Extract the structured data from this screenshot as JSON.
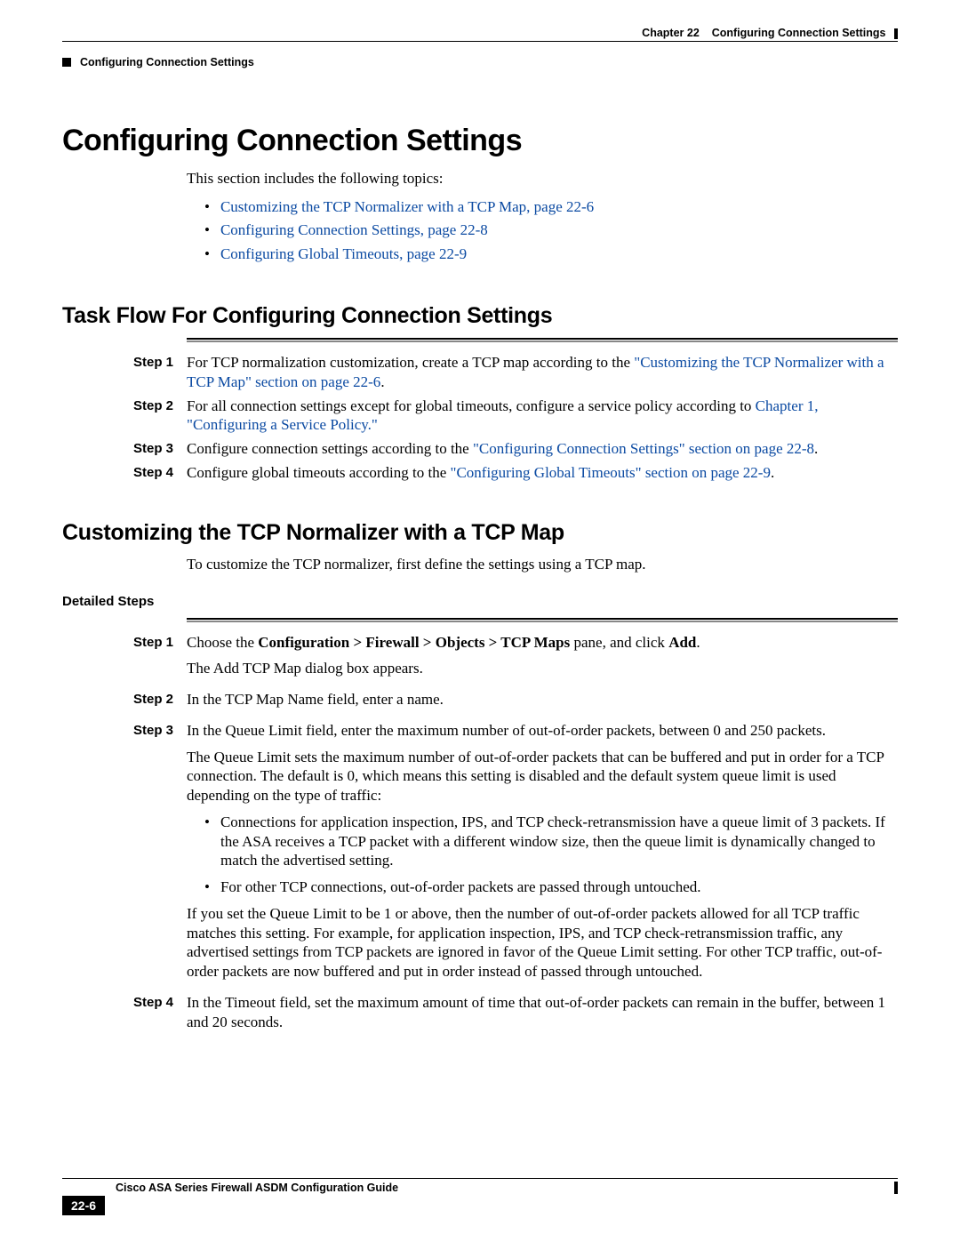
{
  "header": {
    "chapter_label": "Chapter 22",
    "chapter_title": "Configuring Connection Settings",
    "section_title": "Configuring Connection Settings"
  },
  "h1": "Configuring Connection Settings",
  "intro": "This section includes the following topics:",
  "intro_links": [
    "Customizing the TCP Normalizer with a TCP Map, page 22-6",
    "Configuring Connection Settings, page 22-8",
    "Configuring Global Timeouts, page 22-9"
  ],
  "task_flow": {
    "heading": "Task Flow For Configuring Connection Settings",
    "steps": [
      {
        "label": "Step 1",
        "pre": "For TCP normalization customization, create a TCP map according to the ",
        "link": "\"Customizing the TCP Normalizer with a TCP Map\" section on page 22-6",
        "post": "."
      },
      {
        "label": "Step 2",
        "pre": "For all connection settings except for global timeouts, configure a service policy according to ",
        "link": "Chapter 1, \"Configuring a Service Policy.\"",
        "post": ""
      },
      {
        "label": "Step 3",
        "pre": "Configure connection settings according to the ",
        "link": "\"Configuring Connection Settings\" section on page 22-8",
        "post": "."
      },
      {
        "label": "Step 4",
        "pre": "Configure global timeouts according to the ",
        "link": "\"Configuring Global Timeouts\" section on page 22-9",
        "post": "."
      }
    ]
  },
  "custom": {
    "heading": "Customizing the TCP Normalizer with a TCP Map",
    "intro": "To customize the TCP normalizer, first define the settings using a TCP map.",
    "detailed_heading": "Detailed Steps",
    "steps": {
      "s1": {
        "label": "Step 1",
        "line1_pre": "Choose the ",
        "line1_bold": "Configuration > Firewall > Objects > TCP Maps",
        "line1_mid": " pane, and click ",
        "line1_bold2": "Add",
        "line1_post": ".",
        "line2": "The Add TCP Map dialog box appears."
      },
      "s2": {
        "label": "Step 2",
        "text": "In the TCP Map Name field, enter a name."
      },
      "s3": {
        "label": "Step 3",
        "p1": "In the Queue Limit field, enter the maximum number of out-of-order packets, between 0 and 250 packets.",
        "p2": "The Queue Limit sets the maximum number of out-of-order packets that can be buffered and put in order for a TCP connection. The default is 0, which means this setting is disabled and the default system queue limit is used depending on the type of traffic:",
        "b1": "Connections for application inspection, IPS, and TCP check-retransmission have a queue limit of 3 packets. If the ASA receives a TCP packet with a different window size, then the queue limit is dynamically changed to match the advertised setting.",
        "b2": "For other TCP connections, out-of-order packets are passed through untouched.",
        "p3": "If you set the Queue Limit to be 1 or above, then the number of out-of-order packets allowed for all TCP traffic matches this setting. For example, for application inspection, IPS, and TCP check-retransmission traffic, any advertised settings from TCP packets are ignored in favor of the Queue Limit setting. For other TCP traffic, out-of-order packets are now buffered and put in order instead of passed through untouched."
      },
      "s4": {
        "label": "Step 4",
        "text": "In the Timeout field, set the maximum amount of time that out-of-order packets can remain in the buffer, between 1 and 20 seconds."
      }
    }
  },
  "footer": {
    "guide": "Cisco ASA Series Firewall ASDM Configuration Guide",
    "page": "22-6"
  }
}
